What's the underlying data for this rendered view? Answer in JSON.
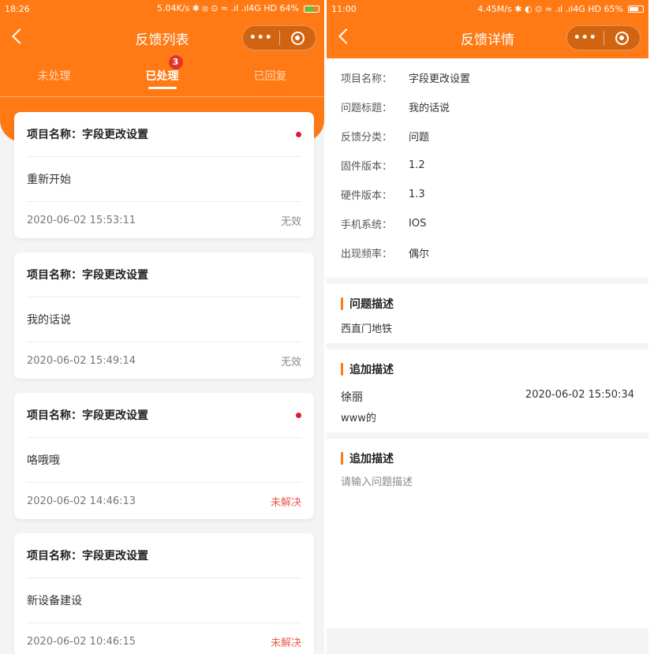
{
  "left": {
    "statusbar": {
      "time": "18:26",
      "right": "5.04K/s ✱ ⦻ ⊙ ≈ .ıl .ıl4G HD 64%",
      "battery_pct": 64
    },
    "nav": {
      "title": "反馈列表",
      "more": "•••"
    },
    "tabs": [
      {
        "label": "未处理"
      },
      {
        "label": "已处理",
        "badge": "3"
      },
      {
        "label": "已回复"
      }
    ],
    "cards": [
      {
        "project": "项目名称：字段更改设置",
        "title": "重新开始",
        "date": "2020-06-02 15:53:11",
        "status": "无效",
        "unread": true,
        "status_color": "#888888"
      },
      {
        "project": "项目名称：字段更改设置",
        "title": "我的话说",
        "date": "2020-06-02 15:49:14",
        "status": "无效",
        "unread": false,
        "status_color": "#888888"
      },
      {
        "project": "项目名称：字段更改设置",
        "title": "咯哦哦",
        "date": "2020-06-02 14:46:13",
        "status": "未解决",
        "unread": true,
        "status_color": "#ee5a4f"
      },
      {
        "project": "项目名称：字段更改设置",
        "title": "新设备建设",
        "date": "2020-06-02 10:46:15",
        "status": "未解决",
        "unread": false,
        "status_color": "#ee5a4f"
      }
    ]
  },
  "right": {
    "statusbar": {
      "time": "11:00",
      "right": "4.45M/s ✱ ◐ ⊙ ≈ .ıl .ıl4G HD 65%",
      "battery_pct": 65
    },
    "nav": {
      "title": "反馈详情",
      "more": "•••"
    },
    "fields": [
      {
        "k": "项目名称：",
        "v": "字段更改设置"
      },
      {
        "k": "问题标题：",
        "v": "我的话说"
      },
      {
        "k": "反馈分类：",
        "v": "问题"
      },
      {
        "k": "固件版本：",
        "v": "1.2"
      },
      {
        "k": "硬件版本：",
        "v": "1.3"
      },
      {
        "k": "手机系统：",
        "v": "IOS"
      },
      {
        "k": "出现频率：",
        "v": "偶尔"
      }
    ],
    "problem": {
      "heading": "问题描述",
      "text": "西直门地铁"
    },
    "append1": {
      "heading": "追加描述",
      "author": "徐丽",
      "time": "2020-06-02 15:50:34",
      "text": "www的"
    },
    "append2": {
      "heading": "追加描述",
      "placeholder": "请输入问题描述"
    }
  },
  "colors": {
    "accent": "#ff7a14",
    "badge": "#e0352b",
    "unread_dot": "#dd1b2e",
    "status_red": "#ee5a4f"
  }
}
